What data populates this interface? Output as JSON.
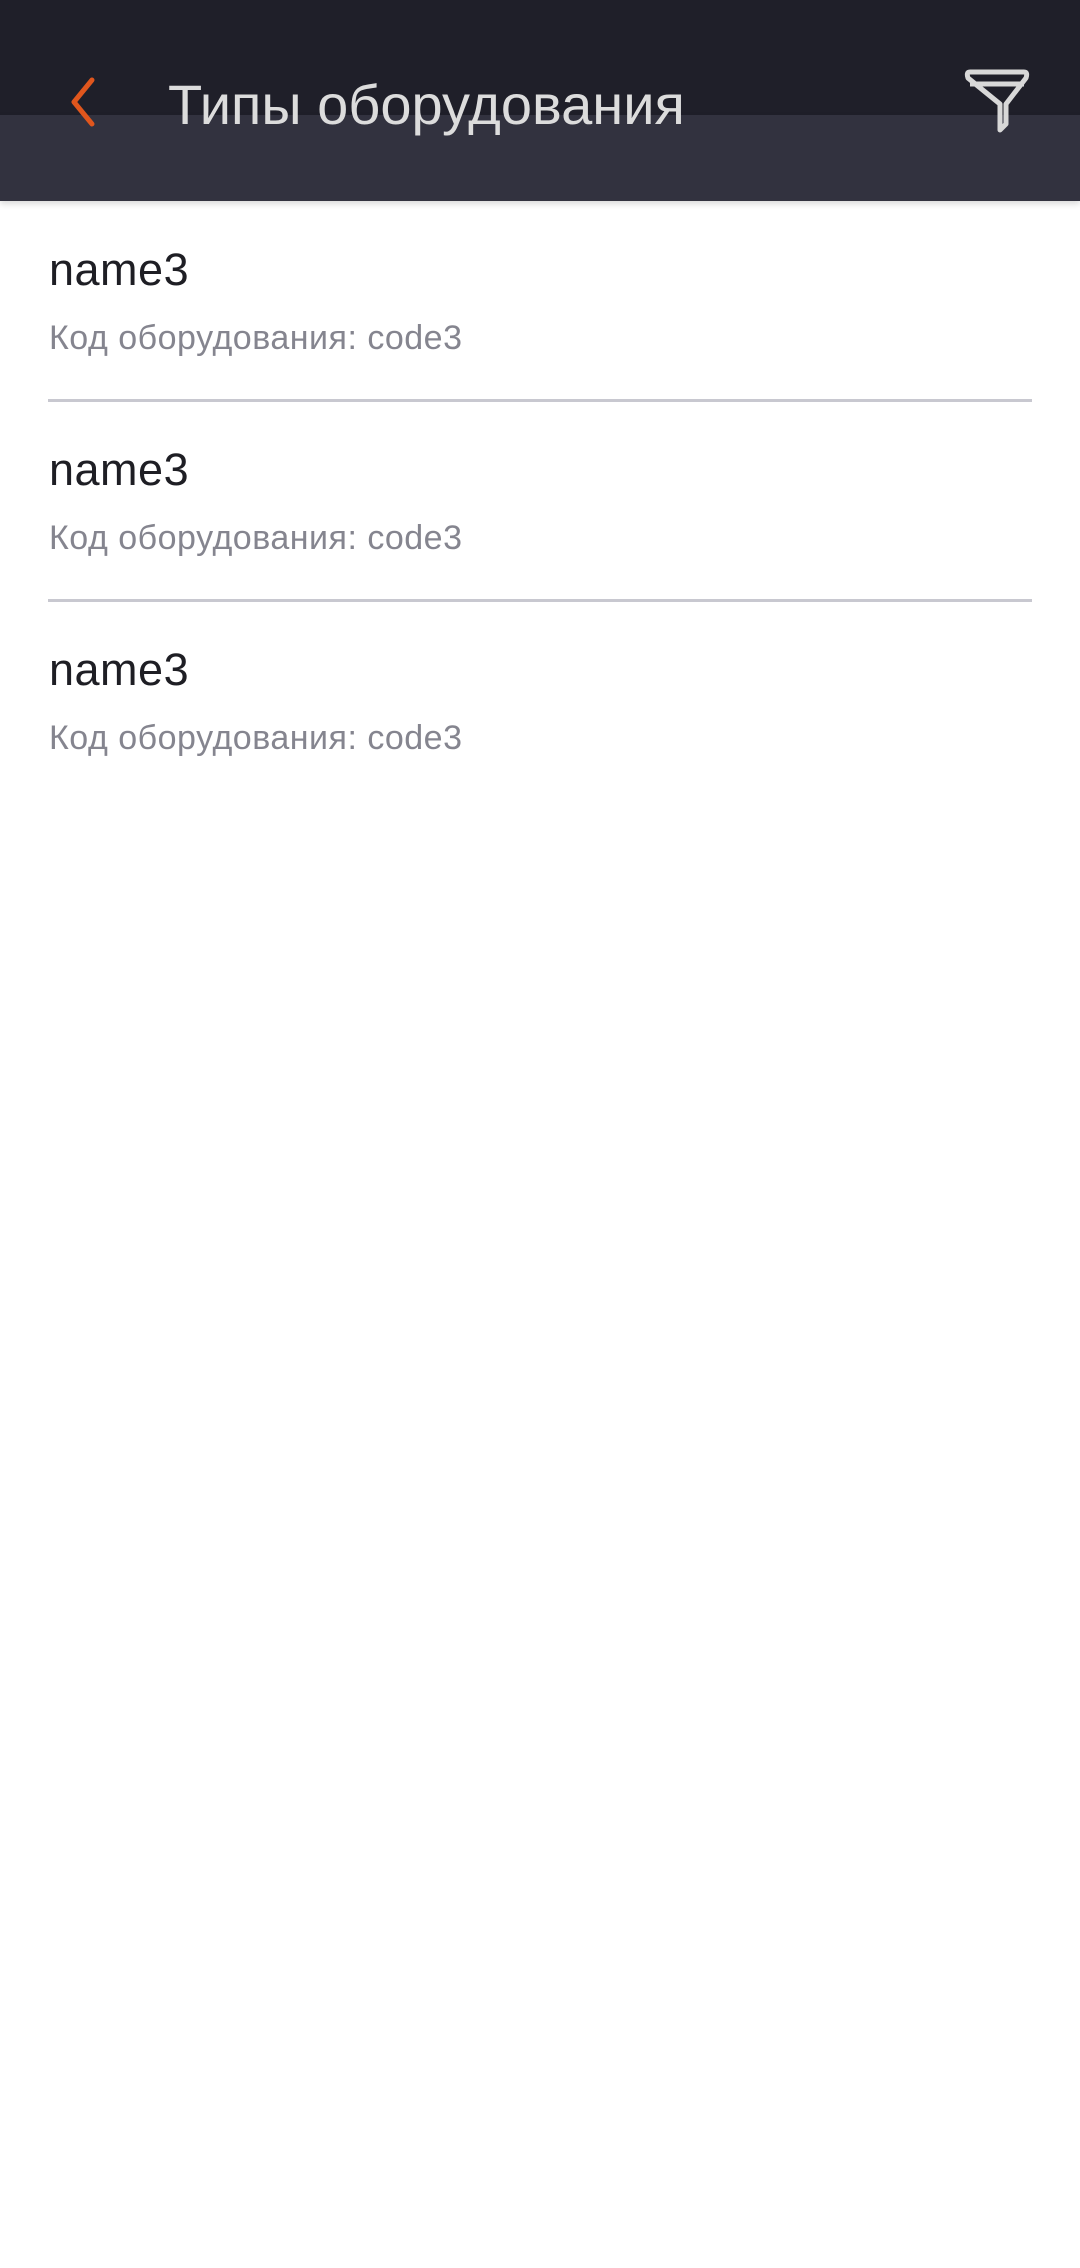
{
  "header": {
    "title": "Типы оборудования",
    "back_icon": "chevron-left-icon",
    "filter_icon": "filter-icon",
    "accent_color": "#e0561d"
  },
  "items": [
    {
      "name": "name3",
      "code": "Код оборудования: code3"
    },
    {
      "name": "name3",
      "code": "Код оборудования: code3"
    },
    {
      "name": "name3",
      "code": "Код оборудования: code3"
    }
  ]
}
